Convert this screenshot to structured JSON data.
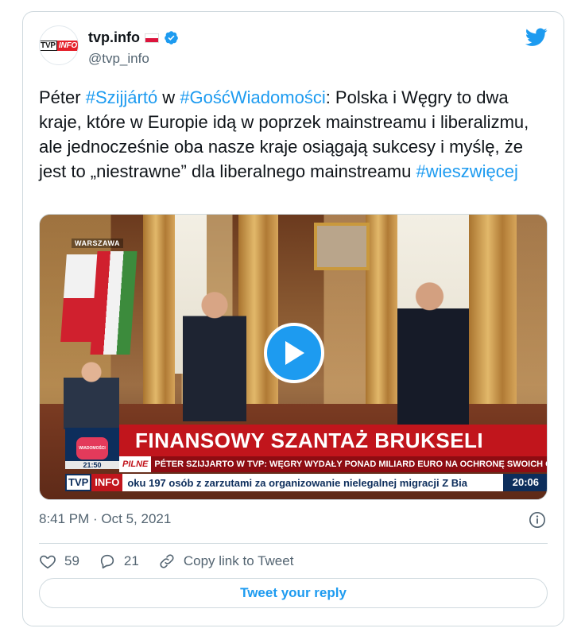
{
  "author": {
    "name": "tvp.info",
    "handle": "@tvp_info",
    "avatar_text_a": "TVP",
    "avatar_text_b": "INFO"
  },
  "tweet": {
    "segments": [
      {
        "text": "Péter ",
        "type": "text"
      },
      {
        "text": "#Szijjártó",
        "type": "hashtag"
      },
      {
        "text": " w ",
        "type": "text"
      },
      {
        "text": "#GośćWiadomości",
        "type": "hashtag"
      },
      {
        "text": ": Polska i Węgry to dwa kraje, które w Europie idą w poprzek mainstreamu i liberalizmu, ale jednocześnie oba nasze kraje osiągają sukcesy i myślę, że jest to „niestrawne” dla liberalnego mainstreamu ",
        "type": "text"
      },
      {
        "text": "#wieszwięcej",
        "type": "hashtag"
      }
    ]
  },
  "video": {
    "location": "WARSZAWA",
    "headline": "FINANSOWY SZANTAŻ BRUKSELI",
    "pilne_label": "PILNE",
    "subheadline": "PÉTER SZIJJARTO W TVP: WĘGRY WYDAŁY PONAD MILIARD EURO NA OCHRONĘ SWOICH GRANIC",
    "show_logo_text": "WIADOMOŚCI",
    "show_time": "21:50",
    "ticker_logo_a": "TVP",
    "ticker_logo_b": "INFO",
    "ticker_text": "oku 197 osób z zarzutami za organizowanie nielegalnej migracji Z Bia",
    "clock": "20:06"
  },
  "timestamp": "8:41 PM · Oct 5, 2021",
  "actions": {
    "likes": "59",
    "replies": "21",
    "copy_link": "Copy link to Tweet"
  },
  "reply_button": "Tweet your reply",
  "colors": {
    "accent": "#1d9bf0",
    "text": "#0f1419",
    "muted": "#536471",
    "border": "#cfd9de"
  }
}
